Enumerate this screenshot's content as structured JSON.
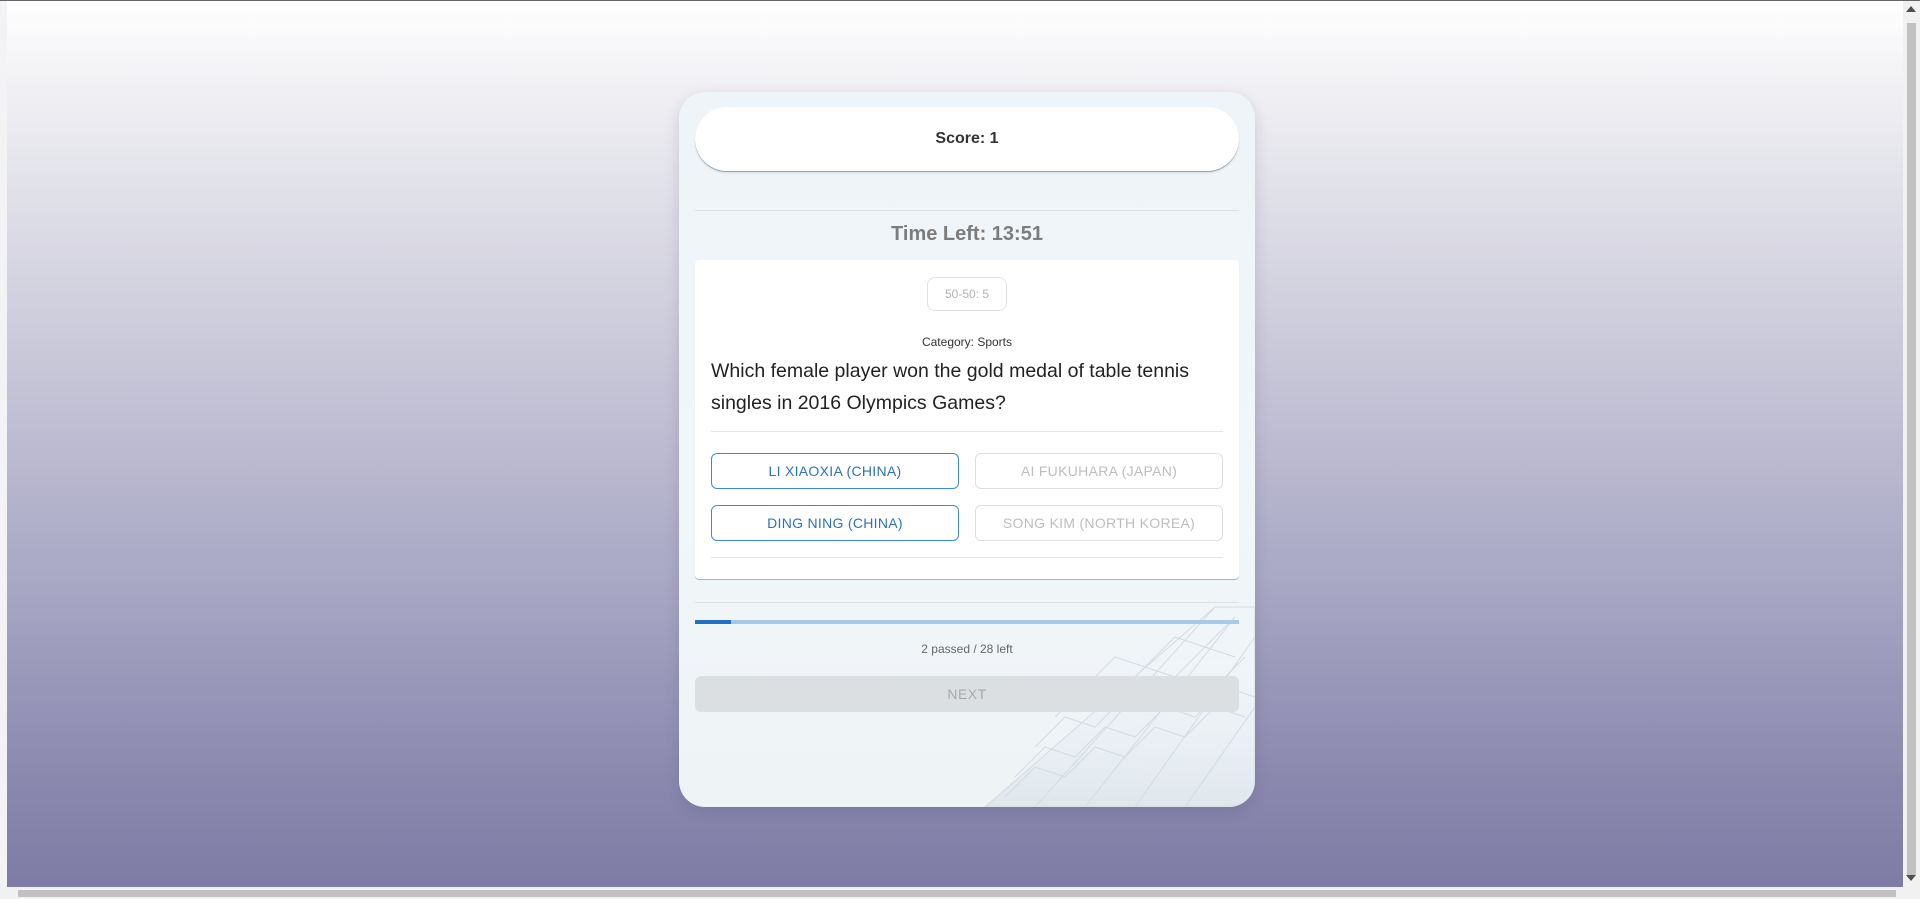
{
  "score_label": "Score: 1",
  "timer_label": "Time Left: 13:51",
  "lifeline": {
    "label": "50-50: 5",
    "enabled": false
  },
  "question": {
    "category_label": "Category: Sports",
    "text": "Which female player won the gold medal of table tennis singles in 2016 Olympics Games?"
  },
  "answers": [
    {
      "label": "LI XIAOXIA (CHINA)",
      "state": "active"
    },
    {
      "label": "AI FUKUHARA (JAPAN)",
      "state": "disabled"
    },
    {
      "label": "DING NING (CHINA)",
      "state": "active"
    },
    {
      "label": "SONG KIM (NORTH KOREA)",
      "state": "disabled"
    }
  ],
  "progress": {
    "fraction": 0.067,
    "label": "2 passed / 28 left"
  },
  "next_label": "NEXT",
  "colors": {
    "accent": "#1f6fc5",
    "answer_active": "#2a72c2",
    "answer_disabled": "#bdbdbd"
  }
}
